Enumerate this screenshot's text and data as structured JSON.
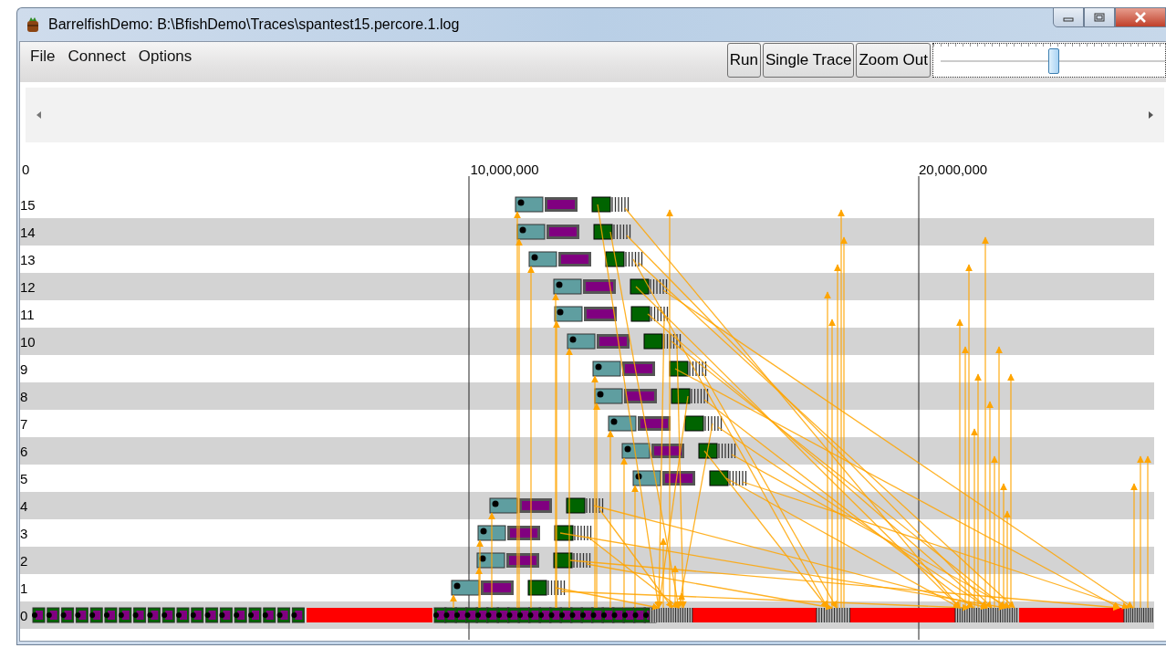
{
  "window": {
    "title": "BarrelfishDemo: B:\\BfishDemo\\Traces\\spantest15.percore.1.log"
  },
  "menu": [
    "File",
    "Connect",
    "Options"
  ],
  "toolbar": {
    "buttons": [
      "Run",
      "Single Trace",
      "Zoom Out"
    ],
    "zoom_slider": {
      "level": 0.52
    }
  },
  "timeline": {
    "axis_labels": [
      "0",
      "10,000,000",
      "20,000,000"
    ],
    "rows": [
      "15",
      "14",
      "13",
      "12",
      "11",
      "10",
      "9",
      "8",
      "7",
      "6",
      "5",
      "4",
      "3",
      "2",
      "1",
      "0"
    ]
  }
}
